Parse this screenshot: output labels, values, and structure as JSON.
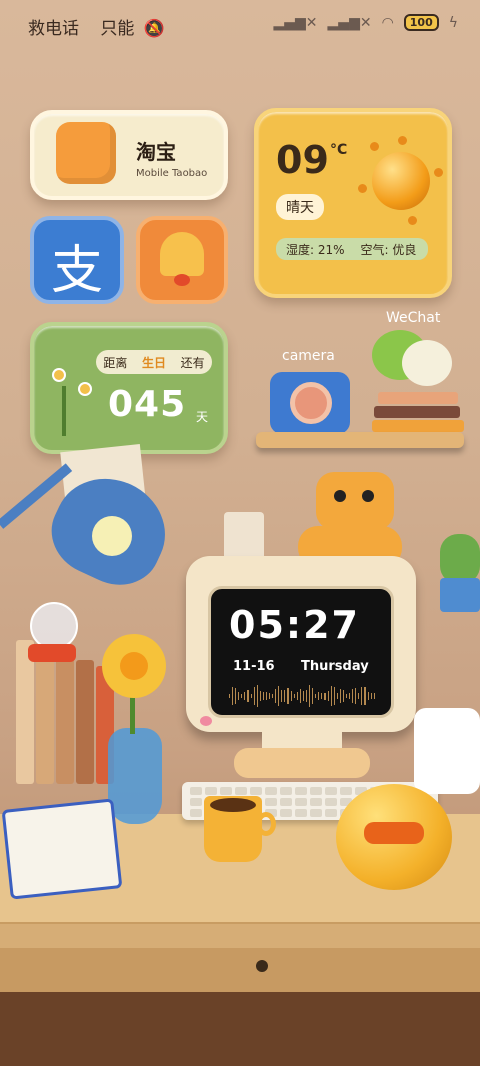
{
  "status_bar": {
    "left_text": "救电话",
    "left_text2": "只能",
    "battery": "100"
  },
  "taobao": {
    "title": "淘宝",
    "subtitle": "Mobile Taobao"
  },
  "weather": {
    "temp": "09",
    "unit": "°C",
    "condition": "晴天",
    "humidity": "湿度: 21%",
    "air": "空气: 优良"
  },
  "birthday": {
    "pill_left": "距离",
    "pill_mid": "生日",
    "pill_right": "还有",
    "days": "045",
    "unit": "天"
  },
  "labels": {
    "camera": "camera",
    "wechat": "WeChat"
  },
  "clock": {
    "time": "05:27",
    "date": "11-16",
    "weekday": "Thursday"
  },
  "colors": {
    "weather": "#f3c04a",
    "birthday": "#8fb561",
    "alipay": "#3c7dd2",
    "bell_app": "#f08a3a"
  }
}
